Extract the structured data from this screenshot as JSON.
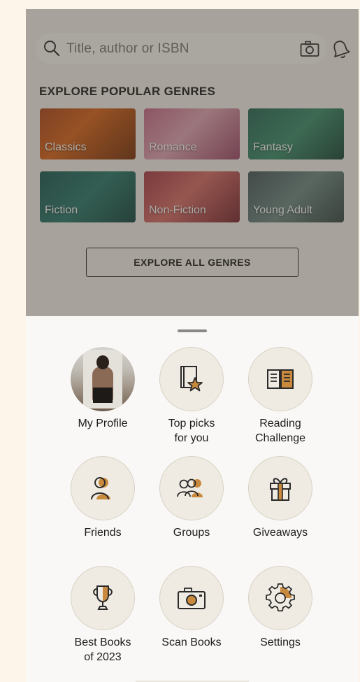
{
  "search": {
    "placeholder": "Title, author or ISBN"
  },
  "genres": {
    "title": "EXPLORE POPULAR GENRES",
    "items": [
      "Classics",
      "Romance",
      "Fantasy",
      "Fiction",
      "Non-Fiction",
      "Young Adult"
    ],
    "explore_all": "EXPLORE ALL GENRES"
  },
  "menu": {
    "items": [
      {
        "label": "My Profile",
        "icon": "avatar"
      },
      {
        "label": "Top picks\nfor you",
        "icon": "book-star-icon"
      },
      {
        "label": "Reading\nChallenge",
        "icon": "open-book-icon"
      },
      {
        "label": "Friends",
        "icon": "friends-icon"
      },
      {
        "label": "Groups",
        "icon": "groups-icon"
      },
      {
        "label": "Giveaways",
        "icon": "gift-icon"
      },
      {
        "label": "Best Books\nof 2023",
        "icon": "trophy-icon"
      },
      {
        "label": "Scan Books",
        "icon": "camera-icon"
      },
      {
        "label": "Settings",
        "icon": "gear-icon"
      }
    ]
  },
  "colors": {
    "accent": "#c98a3e",
    "icon_stroke": "#2a2a2a",
    "tile_bg": "#efebe3"
  }
}
